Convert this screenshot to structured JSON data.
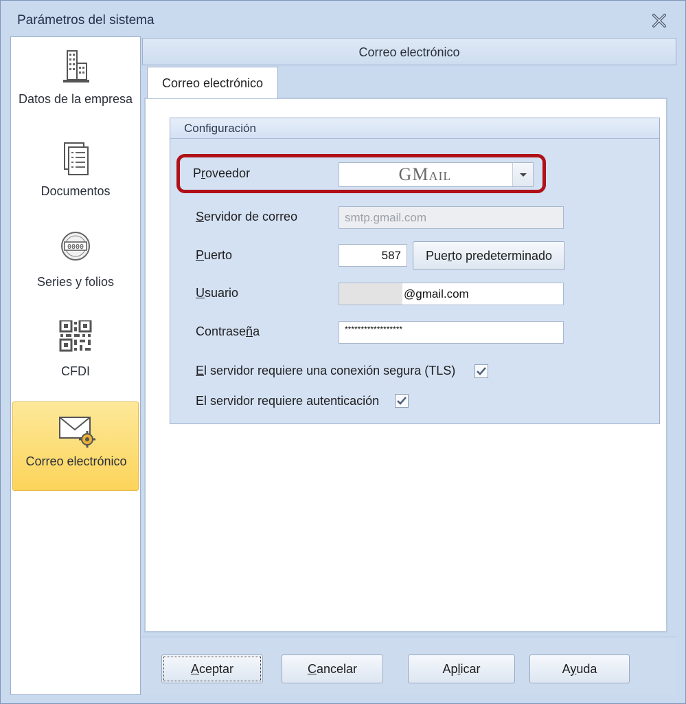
{
  "window": {
    "title": "Parámetros del sistema"
  },
  "sidebar": {
    "items": [
      {
        "label": "Datos de la empresa",
        "icon": "building-icon",
        "active": false
      },
      {
        "label": "Documentos",
        "icon": "documents-icon",
        "active": false
      },
      {
        "label": "Series y folios",
        "icon": "counter-icon",
        "active": false
      },
      {
        "label": "CFDI",
        "icon": "qr-code-icon",
        "active": false
      },
      {
        "label": "Correo electrónico",
        "icon": "envelope-gear-icon",
        "active": true
      }
    ]
  },
  "panel": {
    "header": "Correo electrónico",
    "tab": "Correo electrónico",
    "group_title": "Configuración"
  },
  "form": {
    "provider": {
      "label_pre": "P",
      "label_u": "r",
      "label_post": "oveedor",
      "value": "GMail"
    },
    "server": {
      "label_pre": "",
      "label_u": "S",
      "label_post": "ervidor de correo",
      "value": "smtp.gmail.com"
    },
    "port": {
      "label_pre": "",
      "label_u": "P",
      "label_post": "uerto",
      "value": "587"
    },
    "default_port_button": {
      "pre": "Pue",
      "u": "r",
      "post": "to predeterminado"
    },
    "user": {
      "label_pre": "",
      "label_u": "U",
      "label_post": "suario",
      "value": "@gmail.com"
    },
    "password": {
      "label_pre": "Contrase",
      "label_u": "ñ",
      "label_post": "a",
      "value": "******************"
    },
    "tls": {
      "pre": "",
      "u": "E",
      "post": "l servidor requiere una conexión segura (TLS)",
      "checked": true
    },
    "auth": {
      "label": "El servidor requiere autenticación",
      "checked": true
    }
  },
  "buttons": {
    "accept": {
      "pre": "",
      "u": "A",
      "post": "ceptar"
    },
    "cancel": {
      "pre": "",
      "u": "C",
      "post": "ancelar"
    },
    "apply": {
      "pre": "Ap",
      "u": "l",
      "post": "icar"
    },
    "help": {
      "pre": "A",
      "u": "y",
      "post": "uda"
    }
  },
  "colors": {
    "highlight": "#b01018",
    "active_nav": "#fcd45a",
    "window_bg": "#c9d9ee"
  }
}
